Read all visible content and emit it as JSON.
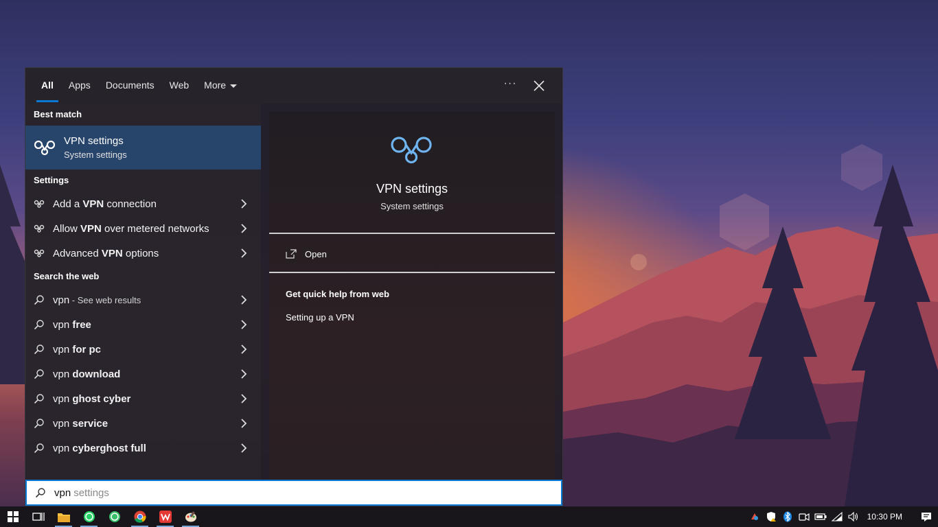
{
  "tabs": [
    {
      "label": "All",
      "active": true
    },
    {
      "label": "Apps"
    },
    {
      "label": "Documents"
    },
    {
      "label": "Web"
    },
    {
      "label": "More"
    }
  ],
  "best_match": {
    "heading": "Best match",
    "title": "VPN settings",
    "subtitle": "System settings",
    "icon": "vpn-icon"
  },
  "settings": {
    "heading": "Settings",
    "items": [
      {
        "pre": "Add a ",
        "bold": "VPN",
        "post": " connection"
      },
      {
        "pre": "Allow ",
        "bold": "VPN",
        "post": " over metered networks"
      },
      {
        "pre": "Advanced ",
        "bold": "VPN",
        "post": " options"
      }
    ]
  },
  "web": {
    "heading": "Search the web",
    "items": [
      {
        "pre": "vpn",
        "bold": "",
        "sub": " - See web results"
      },
      {
        "pre": "vpn ",
        "bold": "free",
        "sub": ""
      },
      {
        "pre": "vpn ",
        "bold": "for pc",
        "sub": ""
      },
      {
        "pre": "vpn ",
        "bold": "download",
        "sub": ""
      },
      {
        "pre": "vpn ",
        "bold": "ghost cyber",
        "sub": ""
      },
      {
        "pre": "vpn ",
        "bold": "service",
        "sub": ""
      },
      {
        "pre": "vpn ",
        "bold": "cyberghost full",
        "sub": ""
      }
    ]
  },
  "preview": {
    "title": "VPN settings",
    "subtitle": "System settings",
    "open_label": "Open",
    "help_heading": "Get quick help from web",
    "help_link": "Setting up a VPN"
  },
  "search": {
    "typed": "vpn",
    "suggestion": "settings"
  },
  "taskbar": {
    "time": "10:30 PM",
    "apps": [
      "windows-start",
      "task-view",
      "file-explorer",
      "whatsapp",
      "whatsapp-2",
      "chrome",
      "wps-office",
      "paint"
    ]
  },
  "colors": {
    "accent": "#0a78d4",
    "best_match_bg": "#27446b",
    "vpn_icon": "#6fb4ee"
  }
}
